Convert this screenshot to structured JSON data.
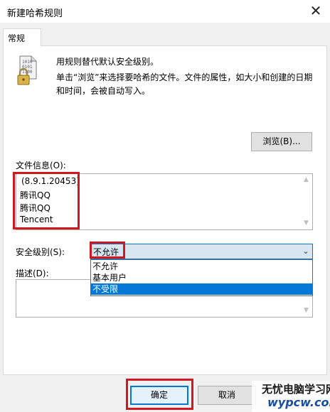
{
  "window": {
    "title": "新建哈希规则",
    "close_glyph": "✕"
  },
  "tabs": [
    {
      "label": "常规"
    }
  ],
  "description_lines": [
    "用规则替代默认安全级别。",
    "单击“浏览”来选择要哈希的文件。文件的属性，如大小和创建的日期",
    "和时间，会被自动写入。"
  ],
  "browse_button": "浏览(B)...",
  "file_info": {
    "label": "文件信息(O):",
    "lines": [
      "(8.9.1.20453)",
      "腾讯QQ",
      "腾讯QQ",
      "Tencent"
    ]
  },
  "security": {
    "label": "安全级别(S):",
    "selected": "不允许",
    "options": [
      "不允许",
      "基本用户",
      "不受限"
    ],
    "highlighted_option": "不受限"
  },
  "description_field": {
    "label": "描述(D):",
    "value": ""
  },
  "buttons": {
    "ok": "确定",
    "cancel": "取消"
  },
  "watermark": {
    "name": "无忧电脑学习网",
    "url": "wypcw.com"
  },
  "colors": {
    "annotation_red": "#d01820",
    "accent": "#0078d7",
    "selection": "#0078d7"
  }
}
